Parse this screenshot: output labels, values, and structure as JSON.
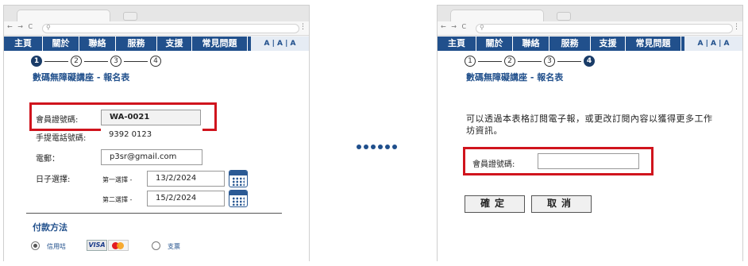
{
  "browser": {
    "nav_buttons": "← → C",
    "menu": [
      "主頁",
      "關於",
      "聯絡",
      "服務",
      "支援",
      "常見問題"
    ],
    "font_size_control": "A | A | A"
  },
  "steps": [
    "1",
    "2",
    "3",
    "4"
  ],
  "form_title": "數碼無障礙講座 - 報名表",
  "form": {
    "member_id_label": "會員證號碼:",
    "member_id_value": "WA-0021",
    "phone_label": "手提電話號碼:",
    "phone_value": "9392 0123",
    "email_label": "電郵：",
    "email_value": "p3sr@gmail.com",
    "date_label": "日子選擇:",
    "first_choice_label": "第一選擇 -",
    "first_choice_value": "13/2/2024",
    "second_choice_label": "第二選擇 -",
    "second_choice_value": "15/2/2024",
    "payment_title": "付款方法",
    "credit_card_label": "信用咭",
    "visa_logo_text": "VISA",
    "cheque_label": "支票"
  },
  "subscribe": {
    "description": "可以透過本表格訂閱電子報，或更改訂閱內容以獲得更多工作坊資訊。",
    "member_id_label": "會員證號碼:",
    "member_id_value": "",
    "confirm_label": "確定",
    "cancel_label": "取消"
  },
  "colors": {
    "nav_bg": "#21508c",
    "title_blue": "#21508c",
    "highlight_red": "#d0141d",
    "step_active": "#1a3c68"
  }
}
